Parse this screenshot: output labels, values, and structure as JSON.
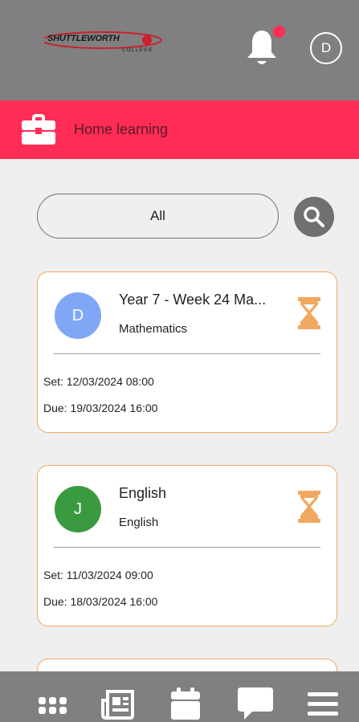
{
  "app": {
    "logo_text": "SHUTTLEWORTH",
    "logo_subtext": "COLLEGE",
    "avatar_initial": "D"
  },
  "header": {
    "title": "Home learning",
    "icon": "briefcase-icon"
  },
  "filter": {
    "value": "All"
  },
  "assignments": [
    {
      "initial": "D",
      "avatar_color": "#7fa7f5",
      "title": "Year 7 -  Week 24 Ma...",
      "subject": "Mathematics",
      "set": "Set: 12/03/2024 08:00",
      "due": "Due: 19/03/2024 16:00",
      "status_icon": "hourglass-icon"
    },
    {
      "initial": "J",
      "avatar_color": "#3a9a3f",
      "title": "English",
      "subject": "English",
      "set": "Set: 11/03/2024 09:00",
      "due": "Due: 18/03/2024 16:00",
      "status_icon": "hourglass-icon"
    }
  ],
  "colors": {
    "accent": "#ff2d55",
    "bar": "#808080",
    "card_border": "#f0a860",
    "hourglass": "#f0a860"
  },
  "bottom_nav": [
    "apps-grid-icon",
    "newspaper-icon",
    "calendar-icon",
    "chat-bubble-icon",
    "hamburger-menu-icon"
  ]
}
